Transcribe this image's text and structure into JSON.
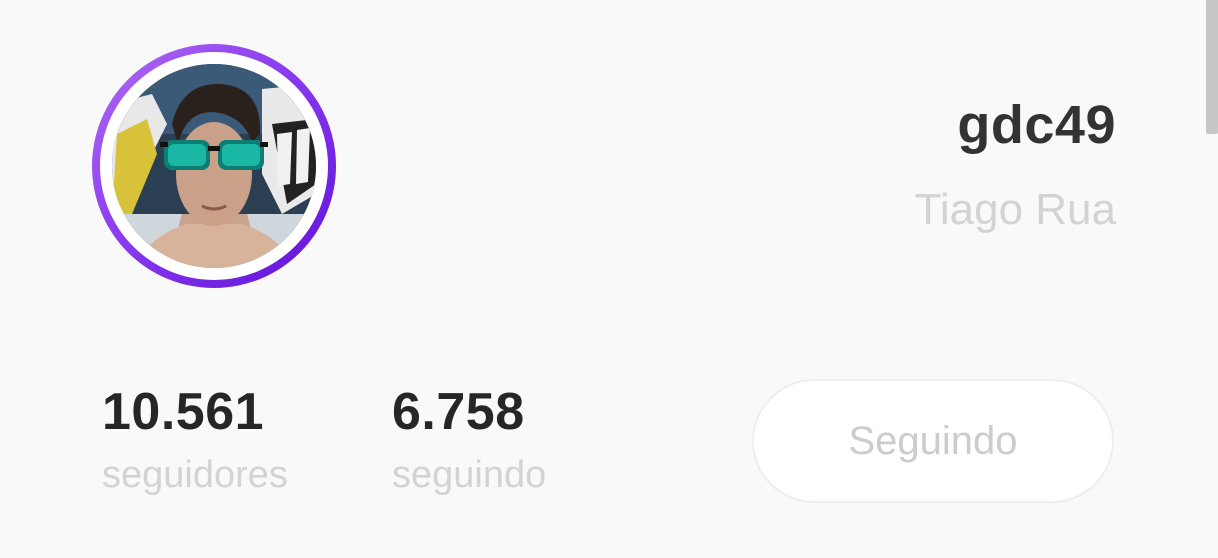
{
  "profile": {
    "username": "gdc49",
    "display_name": "Tiago Rua",
    "avatar_icon": "profile-photo"
  },
  "stats": {
    "followers_count": "10.561",
    "followers_label": "seguidores",
    "following_count": "6.758",
    "following_label": "seguindo"
  },
  "actions": {
    "follow_button_label": "Seguindo"
  },
  "colors": {
    "story_ring_start": "#b16cf2",
    "story_ring_end": "#5f10d8",
    "background": "#f9f9f9",
    "username": "#333333",
    "muted_text": "#d3d3d3"
  }
}
